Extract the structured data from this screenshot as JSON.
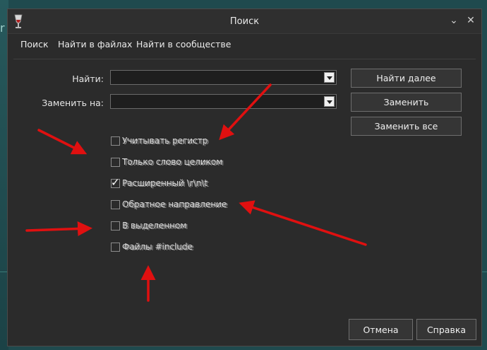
{
  "background": {
    "partial_letter": "r"
  },
  "window": {
    "title": "Поиск",
    "minimize_glyph": "⌄",
    "close_glyph": "✕"
  },
  "tabs": [
    "Поиск",
    "Найти в файлах",
    "Найти в сообществе"
  ],
  "form": {
    "find_label": "Найти:",
    "find_value": "",
    "replace_label": "Заменить на:",
    "replace_value": ""
  },
  "buttons": {
    "find_next": "Найти далее",
    "replace": "Заменить",
    "replace_all": "Заменить все",
    "cancel": "Отмена",
    "help": "Справка"
  },
  "options": [
    {
      "label": "Учитывать регистр",
      "checked": false
    },
    {
      "label": "Только слово целиком",
      "checked": false
    },
    {
      "label": "Расширенный \\r\\n\\t",
      "checked": true
    },
    {
      "label": "Обратное направление",
      "checked": false
    },
    {
      "label": "В выделенном",
      "checked": false
    },
    {
      "label": "Файлы #include",
      "checked": false
    }
  ],
  "checkmark_glyph": "✓",
  "colors": {
    "window_bg": "#2b2b2b",
    "annotation_arrow": "#e01010",
    "desktop_bg": "#1f4a4e"
  }
}
